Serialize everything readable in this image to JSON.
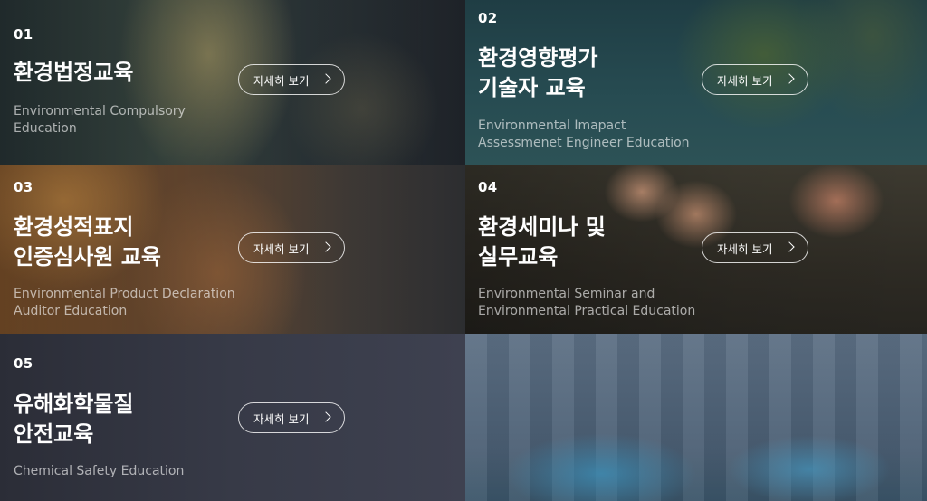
{
  "button_label": "자세히 보기",
  "courses": [
    {
      "num": "01",
      "title": [
        "환경법정교육"
      ],
      "subtitle": [
        "Environmental Compulsory",
        "Education"
      ]
    },
    {
      "num": "02",
      "title": [
        "환경영향평가",
        "기술자 교육"
      ],
      "subtitle": [
        "Environmental Imapact",
        "Assessmenet Engineer Education"
      ]
    },
    {
      "num": "03",
      "title": [
        "환경성적표지",
        "인증심사원 교육"
      ],
      "subtitle": [
        "Environmental Product Declaration",
        "Auditor Education"
      ]
    },
    {
      "num": "04",
      "title": [
        "환경세미나 및",
        "실무교육"
      ],
      "subtitle": [
        "Environmental Seminar and",
        "Environmental Practical Education"
      ]
    },
    {
      "num": "05",
      "title": [
        "유해화학물질",
        "안전교육"
      ],
      "subtitle": [
        "Chemical Safety Education"
      ]
    }
  ]
}
